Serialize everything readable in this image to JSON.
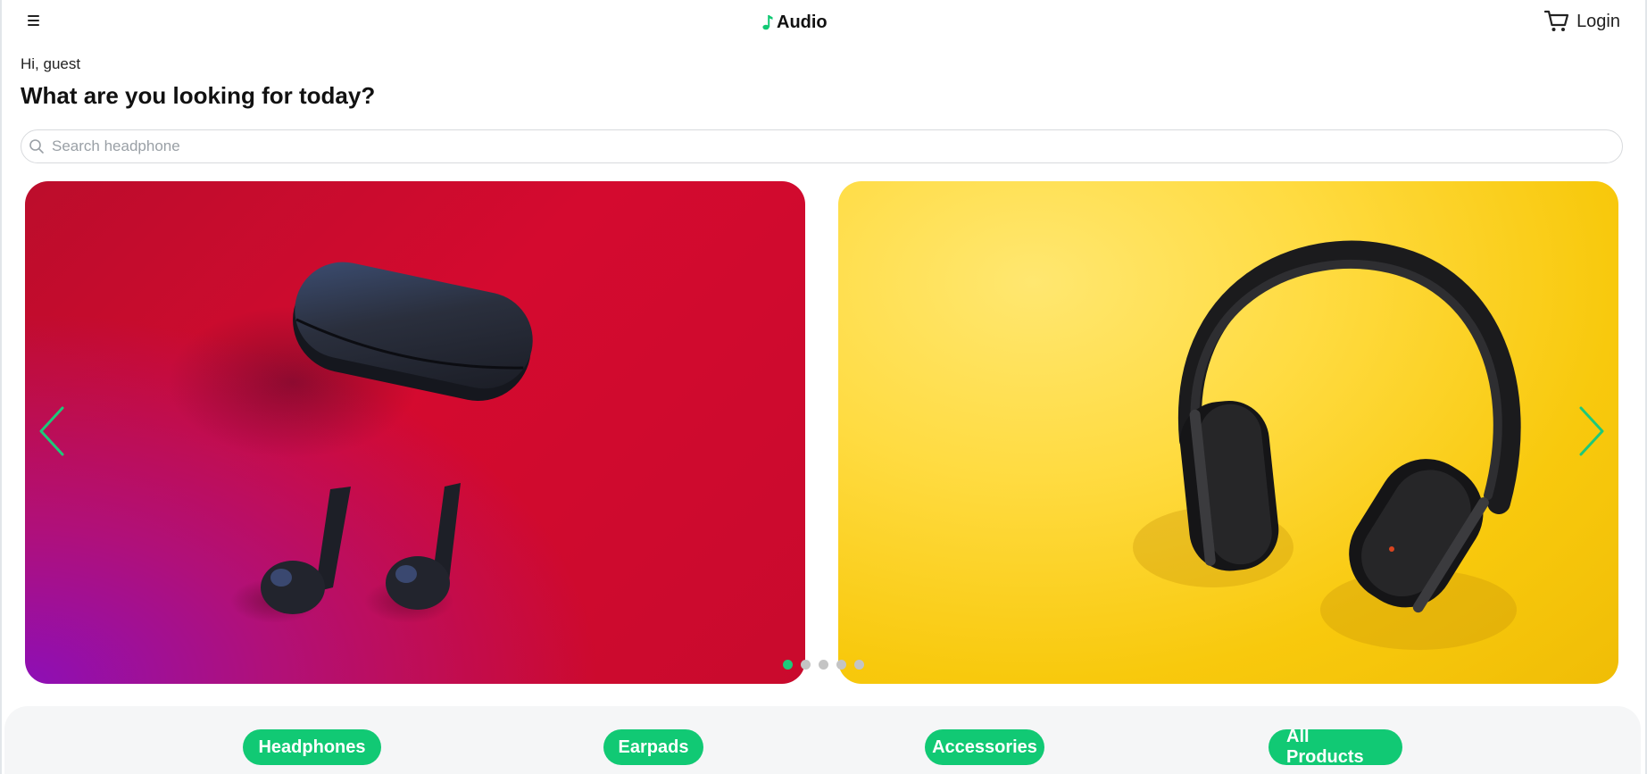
{
  "header": {
    "brand_name": "Audio",
    "login_label": "Login"
  },
  "greeting": {
    "hello": "Hi, guest",
    "headline": "What are you looking for today?"
  },
  "search": {
    "placeholder": "Search headphone",
    "value": ""
  },
  "carousel": {
    "slides": [
      {
        "subject": "wireless earbuds with charging case",
        "background": "#c90a2d"
      },
      {
        "subject": "over-ear headphones",
        "background": "#f8c90d"
      }
    ],
    "dot_count": 5,
    "active_index": 0
  },
  "categories": [
    {
      "label": "Headphones"
    },
    {
      "label": "Earpads"
    },
    {
      "label": "Accessories"
    },
    {
      "label": "All Products"
    }
  ],
  "colors": {
    "accent": "#11c974",
    "arrow": "#1dc97a",
    "text": "#111111"
  },
  "icons": [
    "menu-icon",
    "music-note-icon",
    "cart-icon",
    "search-icon",
    "chevron-left-icon",
    "chevron-right-icon"
  ]
}
